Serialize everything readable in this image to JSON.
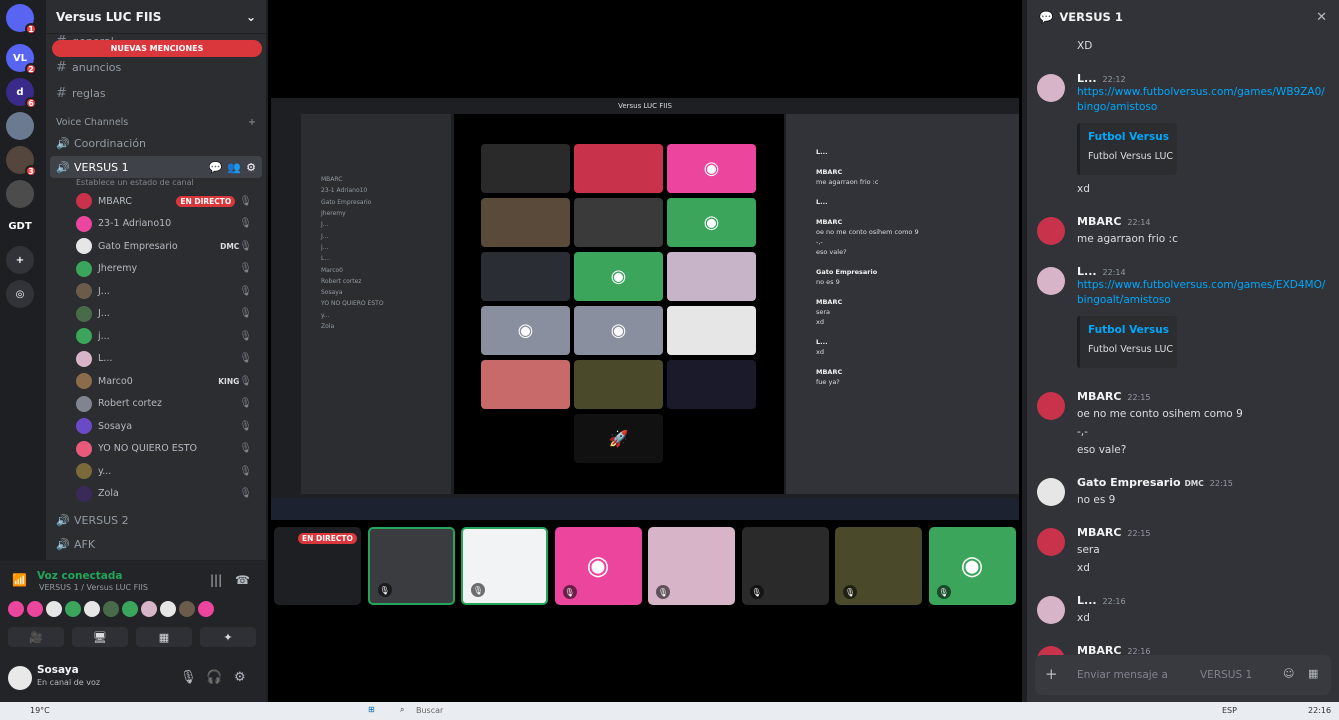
{
  "server": {
    "name": "Versus LUC FIIS",
    "rail": [
      {
        "label": "",
        "badge": "1",
        "color": "#5865f2"
      },
      {
        "label": "VL",
        "badge": "2",
        "color": "#5865f2"
      },
      {
        "label": "d",
        "badge": "6",
        "color": "#3a2a8a"
      },
      {
        "label": "",
        "badge": "",
        "color": "#6b7a90"
      },
      {
        "label": "",
        "badge": "3",
        "color": "#54463d"
      },
      {
        "label": "",
        "badge": "",
        "color": "#4c4c4c"
      },
      {
        "label": "GDT",
        "badge": "",
        "color": "#1e1f22"
      },
      {
        "label": "+",
        "badge": "",
        "color": "#313338"
      },
      {
        "label": "◎",
        "badge": "",
        "color": "#313338"
      }
    ]
  },
  "channels": {
    "mentions_pill": "NUEVAS MENCIONES",
    "text": [
      {
        "name": "general"
      },
      {
        "name": "anuncios"
      },
      {
        "name": "reglas"
      }
    ],
    "voice_category": "Voice Channels",
    "voice": {
      "coordinacion": "Coordinación",
      "versus1": "VERSUS 1",
      "status_placeholder": "Establece un estado de canal",
      "versus2": "VERSUS 2",
      "afk": "AFK"
    },
    "users": [
      {
        "name": "MBARC",
        "live": "EN DIRECTO",
        "color": "#c8324a"
      },
      {
        "name": "23-1 Adriano10",
        "color": "#eb459e"
      },
      {
        "name": "Gato Empresario",
        "tag": "DMC",
        "color": "#e6e6e6"
      },
      {
        "name": "Jheremy",
        "color": "#3ba55c"
      },
      {
        "name": "J...",
        "color": "#6b5b4b"
      },
      {
        "name": "J...",
        "color": "#4a6b4a"
      },
      {
        "name": "j...",
        "color": "#3ba55c"
      },
      {
        "name": "L...",
        "color": "#d8b4c8"
      },
      {
        "name": "Marco0",
        "tag": "KING",
        "color": "#8a6b4a"
      },
      {
        "name": "Robert cortez",
        "color": "#80848e"
      },
      {
        "name": "Sosaya",
        "color": "#6b4ac8"
      },
      {
        "name": "YO NO QUIERO ESTO",
        "color": "#e85a7a"
      },
      {
        "name": "y...",
        "color": "#7a6a3a"
      },
      {
        "name": "Zola",
        "color": "#3a2a5a"
      }
    ]
  },
  "voice_panel": {
    "status": "Voz conectada",
    "sub": "VERSUS 1 / Versus LUC FIIS",
    "avatar_colors": [
      "#eb459e",
      "#eb459e",
      "#e6e6e6",
      "#3ba55c",
      "#e6e6e6",
      "#4a6b4a",
      "#3ba55c",
      "#d8b4c8",
      "#e6e6e6",
      "#6b5b4b",
      "#eb459e"
    ]
  },
  "user": {
    "name": "Sosaya",
    "status": "En canal de voz"
  },
  "stream": {
    "inner_title": "Versus LUC FIIS",
    "live_label": "EN DIRECTO",
    "tiles_colors": [
      "#2a2a2a",
      "#c8324a",
      "#eb459e",
      "#5a4a3a",
      "#3a3a3a",
      "#3ba55c",
      "#2a2d33",
      "#3ba55c",
      "#c8b4c8",
      "#8a8fa0",
      "#8a8fa0",
      "#e6e6e6",
      "#c86a6a",
      "#4a4a2a",
      "#1a1a2a"
    ],
    "bottom_tiles": [
      {
        "color": "#1e1f22",
        "label": "EN DIRECTO"
      },
      {
        "color": "#3a3c40",
        "label": ""
      },
      {
        "color": "#f2f3f5",
        "label": ""
      },
      {
        "color": "#eb459e",
        "label": ""
      },
      {
        "color": "#d8b4c8",
        "label": ""
      },
      {
        "color": "#2a2a2a",
        "label": ""
      },
      {
        "color": "#4a4a2a",
        "label": ""
      },
      {
        "color": "#3ba55c",
        "label": ""
      }
    ]
  },
  "chat": {
    "channel": "VERSUS 1",
    "input_placeholder": "Enviar mensaje a",
    "input_channel": "VERSUS 1",
    "messages": [
      {
        "text": "XD"
      },
      {
        "author": "L...",
        "time": "22:12",
        "link1": "https://www.futbolversus.com/games/WB9ZA0/",
        "link2": "bingo/amistoso",
        "embed_title": "Futbol Versus",
        "embed_desc": "Futbol Versus LUC",
        "after": "xd"
      },
      {
        "author": "MBARC",
        "time": "22:14",
        "text": "me agarraon frio :c"
      },
      {
        "author": "L...",
        "time": "22:14",
        "link1": "https://www.futbolversus.com/games/EXD4MO/",
        "link2": "bingoalt/amistoso",
        "embed_title": "Futbol Versus",
        "embed_desc": "Futbol Versus LUC"
      },
      {
        "author": "MBARC",
        "time": "22:15",
        "lines": [
          "oe no me conto osihem como 9",
          "-,-",
          "eso vale?"
        ]
      },
      {
        "author": "Gato Empresario",
        "tag": "DMC",
        "time": "22:15",
        "text": "no es 9"
      },
      {
        "author": "MBARC",
        "time": "22:15",
        "lines": [
          "sera",
          "xd"
        ]
      },
      {
        "author": "L...",
        "time": "22:16",
        "text": "xd"
      },
      {
        "author": "MBARC",
        "time": "22:16",
        "text": "fue ya?"
      }
    ]
  },
  "taskbar": {
    "temp": "19°C",
    "search": "Buscar",
    "lang": "ESP",
    "time": "22:16"
  },
  "colors": {
    "accent": "#5865f2",
    "live": "#da373c",
    "voice_green": "#23a55a",
    "link": "#00a8fc"
  }
}
